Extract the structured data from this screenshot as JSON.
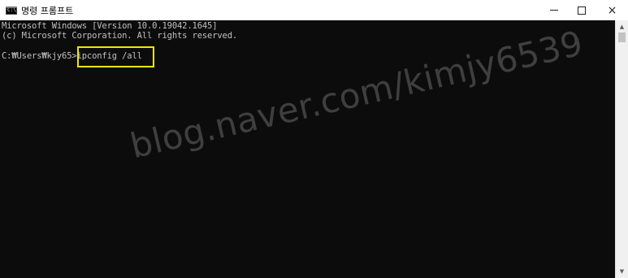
{
  "window": {
    "title": "명령 프롬프트",
    "icon": "cmd-icon",
    "icon_text": "C:\\",
    "controls": {
      "minimize": "minimize-icon",
      "maximize": "maximize-icon",
      "close": "×"
    }
  },
  "console": {
    "lines": [
      "Microsoft Windows [Version 10.0.19042.1645]",
      "(c) Microsoft Corporation. All rights reserved.",
      "C:₩Users₩kjy65>ipconfig /all"
    ],
    "highlight_color": "#f2e600",
    "background_color": "#0c0c0c",
    "text_color": "#c0c0c0"
  },
  "watermark": {
    "text": "blog.naver.com/kimjy6539"
  },
  "scrollbar": {
    "up_arrow": "▲",
    "down_arrow": "▼"
  }
}
